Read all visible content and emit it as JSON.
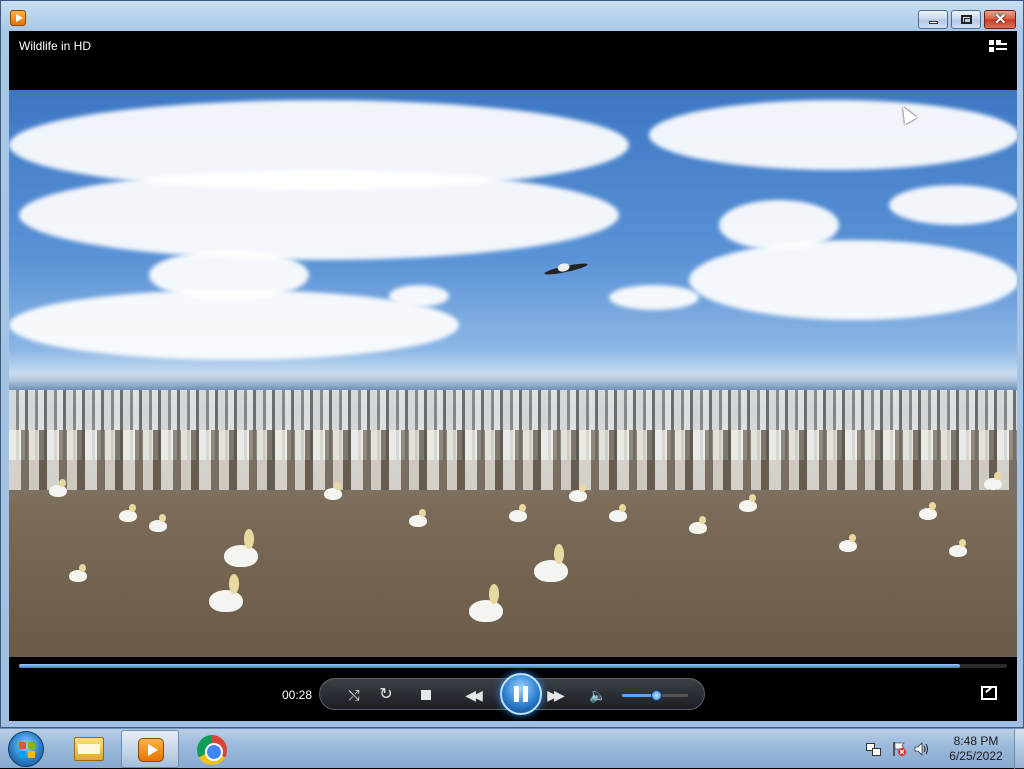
{
  "window": {
    "title": "Wildlife in HD",
    "accent_color": "#2c7fd1"
  },
  "player": {
    "elapsed_time": "00:28",
    "progress_fraction": 0.952,
    "volume_fraction": 0.52,
    "state": "playing",
    "controls": [
      "shuffle-icon",
      "repeat-icon",
      "stop-icon",
      "previous-icon",
      "pause-icon",
      "next-icon",
      "speaker-icon"
    ]
  },
  "taskbar": {
    "items": [
      "start-orb-icon",
      "folder-icon",
      "media-player-icon",
      "chrome-icon"
    ],
    "active_item": "media-player-icon",
    "tray_icons": [
      "network-icon",
      "action-center-flag-icon",
      "speaker-icon"
    ],
    "clock": {
      "time": "8:48 PM",
      "date": "6/25/2022"
    }
  }
}
